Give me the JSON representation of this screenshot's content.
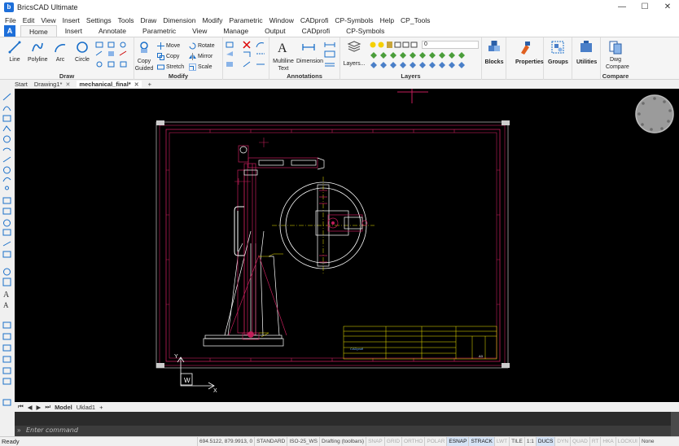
{
  "app": {
    "title": "BricsCAD Ultimate",
    "icon": "bricscad-logo-icon",
    "window_buttons": [
      "—",
      "☐",
      "✕"
    ]
  },
  "menu": [
    "File",
    "Edit",
    "View",
    "Insert",
    "Settings",
    "Tools",
    "Draw",
    "Dimension",
    "Modify",
    "Parametric",
    "Window",
    "CADprofi",
    "CP-Symbols",
    "Help",
    "CP_Tools"
  ],
  "ribbon_tabs": [
    "Home",
    "Insert",
    "Annotate",
    "Parametric",
    "View",
    "Manage",
    "Output",
    "CADprofi",
    "CP-Symbols"
  ],
  "ribbon": {
    "draw": {
      "title": "Draw",
      "tools": [
        "Line",
        "Polyline",
        "Arc",
        "Circle"
      ]
    },
    "modify": {
      "title": "Modify",
      "copy_guided": [
        "Copy",
        "Guided"
      ],
      "tools": [
        "Move",
        "Rotate",
        "Copy",
        "Mirror",
        "Stretch",
        "Scale"
      ]
    },
    "annotations": {
      "title": "Annotations",
      "multiline": [
        "Multiline",
        "Text"
      ],
      "dimension": "Dimension"
    },
    "layers": {
      "title": "Layers",
      "layers_button": "Layers...",
      "current_layer": "0"
    },
    "blocks": "Blocks",
    "properties": "Properties",
    "groups": "Groups",
    "utilities": "Utilities",
    "compare": {
      "title": "Compare",
      "button": [
        "Dwg",
        "Compare"
      ]
    }
  },
  "doc_tabs": [
    {
      "label": "Start",
      "active": false,
      "closable": false
    },
    {
      "label": "Drawing1*",
      "active": false,
      "closable": true
    },
    {
      "label": "mechanical_final*",
      "active": true,
      "closable": true
    }
  ],
  "new_tab": "+",
  "drawing": {
    "title_block": {
      "logo": "CADprofi",
      "page": "A3"
    },
    "ucs": {
      "x": "X",
      "y": "Y",
      "w": "W"
    }
  },
  "layout_tabs": {
    "model": "Model",
    "layout": "Uklad1",
    "add": "+"
  },
  "command": {
    "placeholder": "Enter command"
  },
  "status": {
    "ready": "Ready",
    "coords": "694.5122, 879.9913, 0",
    "style": "STANDARD",
    "dimstyle": "ISO-25_WS",
    "workspace": "Drafting (toolbars)",
    "toggles": [
      {
        "label": "SNAP",
        "on": false
      },
      {
        "label": "GRID",
        "on": false
      },
      {
        "label": "ORTHO",
        "on": false
      },
      {
        "label": "POLAR",
        "on": false
      },
      {
        "label": "ESNAP",
        "on": true
      },
      {
        "label": "STRACK",
        "on": true
      },
      {
        "label": "LWT",
        "on": false
      },
      {
        "label": "TILE",
        "on": true
      },
      {
        "label": "1:1",
        "on": true
      },
      {
        "label": "DUCS",
        "on": true
      },
      {
        "label": "DYN",
        "on": false
      },
      {
        "label": "QUAD",
        "on": false
      },
      {
        "label": "RT",
        "on": false
      },
      {
        "label": "HKA",
        "on": false
      },
      {
        "label": "LOCKUI",
        "on": false
      },
      {
        "label": "None",
        "on": true
      }
    ]
  },
  "colors": {
    "accent": "#1e6fd9",
    "canvas": "#000000",
    "frame": "#c41e5a",
    "drawing": "#ffffff",
    "dims": "#f2e600"
  }
}
